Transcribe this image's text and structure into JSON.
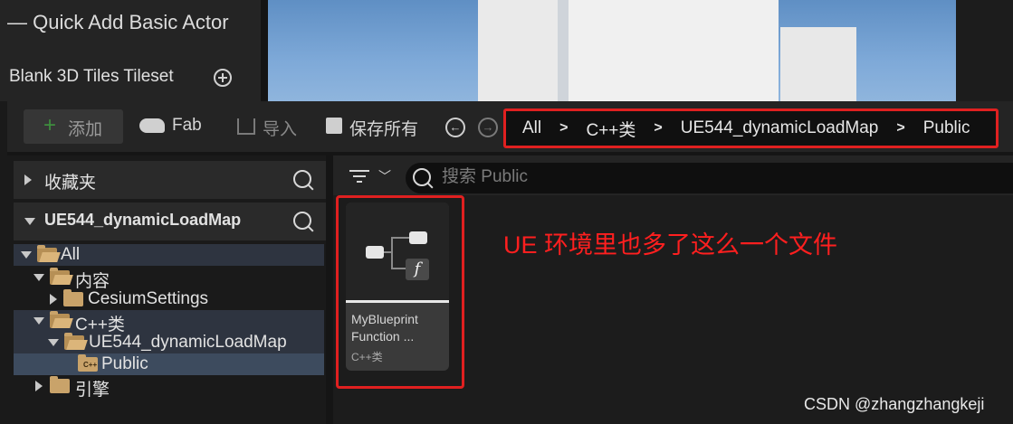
{
  "top_panel": {
    "title": "— Quick Add Basic Actor",
    "item": "Blank 3D Tiles Tileset"
  },
  "toolbar": {
    "add_label": "添加",
    "fab_label": "Fab",
    "import_label": "导入",
    "save_all_label": "保存所有"
  },
  "breadcrumb": [
    "All",
    "C++类",
    "UE544_dynamicLoadMap",
    "Public"
  ],
  "sidebar": {
    "favorites": "收藏夹",
    "project": "UE544_dynamicLoadMap",
    "tree": [
      {
        "label": "All"
      },
      {
        "label": "内容"
      },
      {
        "label": "CesiumSettings"
      },
      {
        "label": "C++类"
      },
      {
        "label": "UE544_dynamicLoadMap"
      },
      {
        "label": "Public"
      },
      {
        "label": "引擎"
      }
    ]
  },
  "search": {
    "placeholder": "搜索 Public",
    "value": ""
  },
  "asset": {
    "name": "MyBlueprint Function ...",
    "type": "C++类"
  },
  "annotation": "UE 环境里也多了这么一个文件",
  "watermark": "CSDN @zhangzhangkeji",
  "colors": {
    "highlight": "#e02020",
    "accent_green": "#3e8e3e",
    "folder": "#c9a36a"
  }
}
